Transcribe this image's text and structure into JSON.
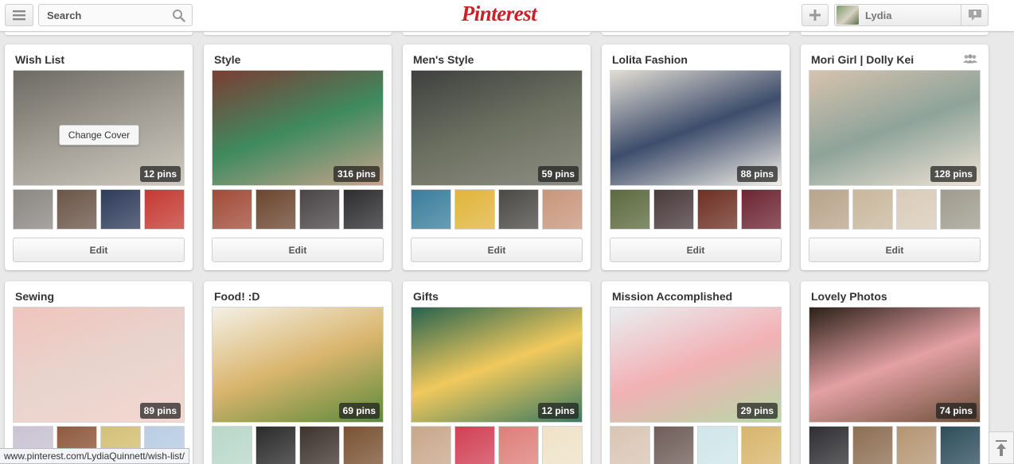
{
  "header": {
    "search_placeholder": "Search",
    "logo_text": "Pinterest",
    "user_name": "Lydia",
    "brand_color": "#cb2027"
  },
  "boards": [
    {
      "title": "Wish List",
      "pins": "12 pins",
      "edit_label": "Edit",
      "hover_label": "Change Cover",
      "cover": [
        "#6d6a64",
        "#a19d94",
        "#cfcac0"
      ],
      "thumbs": [
        "#8b8783",
        "#6b5548",
        "#2e3b5a",
        "#c43a32"
      ]
    },
    {
      "title": "Style",
      "pins": "316 pins",
      "edit_label": "Edit",
      "cover": [
        "#7b3d34",
        "#3f8a5f",
        "#c8a48c"
      ],
      "thumbs": [
        "#a24b38",
        "#6c4630",
        "#4a4546",
        "#2d2d2f"
      ]
    },
    {
      "title": "Men's Style",
      "pins": "59 pins",
      "edit_label": "Edit",
      "cover": [
        "#3f4040",
        "#6c7060",
        "#8d8e84"
      ],
      "thumbs": [
        "#3a7e9c",
        "#e1b43b",
        "#4b4945",
        "#c8967b"
      ]
    },
    {
      "title": "Lolita Fashion",
      "pins": "88 pins",
      "edit_label": "Edit",
      "cover": [
        "#e2ddd3",
        "#3e4d6c",
        "#f2efe6"
      ],
      "thumbs": [
        "#5d6a3e",
        "#4a3a3c",
        "#6e3024",
        "#6d2533"
      ]
    },
    {
      "title": "Mori Girl | Dolly Kei",
      "pins": "128 pins",
      "edit_label": "Edit",
      "cover": [
        "#d7c3ad",
        "#8ea39a",
        "#efe3d3"
      ],
      "thumbs": [
        "#b9a48b",
        "#c8b79c",
        "#d9cbb8",
        "#9f9c8e"
      ]
    },
    {
      "title": "Sewing",
      "pins": "89 pins",
      "edit_label": "Edit",
      "cover": [
        "#f0c4bd",
        "#e8d4cd",
        "#f4d7d0"
      ],
      "thumbs": [
        "#c9c3d3",
        "#8f5a3e",
        "#d4c076",
        "#b9cde4"
      ]
    },
    {
      "title": "Food! :D",
      "pins": "69 pins",
      "edit_label": "Edit",
      "cover": [
        "#f4f0e6",
        "#d9b56c",
        "#5c8a3c"
      ],
      "thumbs": [
        "#b8d7c9",
        "#2b2b2b",
        "#3f342e",
        "#7a5232"
      ]
    },
    {
      "title": "Gifts",
      "pins": "12 pins",
      "edit_label": "Edit",
      "cover": [
        "#27634f",
        "#f1c95d",
        "#3b7a62"
      ],
      "thumbs": [
        "#c8a78a",
        "#d04054",
        "#de7e7a",
        "#efe2c7"
      ]
    },
    {
      "title": "Mission Accomplished",
      "pins": "29 pins",
      "edit_label": "Edit",
      "cover": [
        "#e9eef1",
        "#f2b1b5",
        "#b6d7a6"
      ],
      "thumbs": [
        "#d9c5b3",
        "#6f5d58",
        "#cfe6ea",
        "#d8b56c"
      ]
    },
    {
      "title": "Lovely Photos",
      "pins": "74 pins",
      "edit_label": "Edit",
      "cover": [
        "#2c2118",
        "#e4a0a4",
        "#6b5039"
      ],
      "thumbs": [
        "#2f2f33",
        "#8d6e52",
        "#b49572",
        "#2d4d5b"
      ]
    }
  ],
  "status_bar": {
    "url": "www.pinterest.com/LydiaQuinnett/wish-list/"
  },
  "icons": [
    "menu-icon",
    "search-icon",
    "plus-icon",
    "notification-icon",
    "group-icon",
    "scroll-top-icon"
  ]
}
